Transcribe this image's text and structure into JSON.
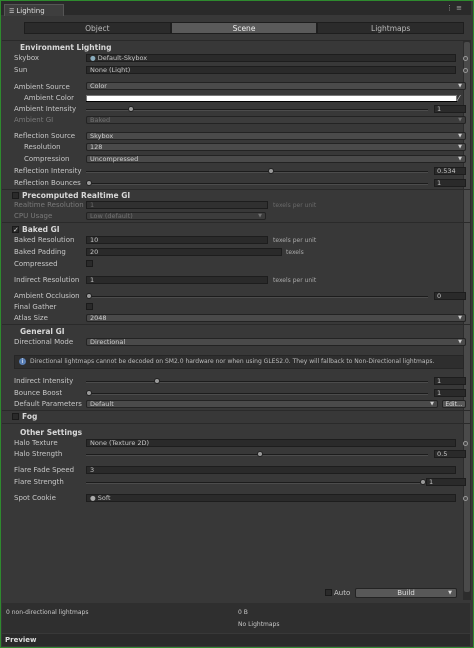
{
  "window": {
    "tab_title": "Lighting"
  },
  "modes": [
    "Object",
    "Scene",
    "Lightmaps"
  ],
  "environment": {
    "title": "Environment Lighting",
    "skybox_label": "Skybox",
    "skybox_value": "Default-Skybox",
    "sun_label": "Sun",
    "sun_value": "None (Light)",
    "ambient_source_label": "Ambient Source",
    "ambient_source_value": "Color",
    "ambient_color_label": "Ambient Color",
    "ambient_intensity_label": "Ambient Intensity",
    "ambient_intensity_value": "1",
    "ambient_gi_label": "Ambient GI",
    "ambient_gi_value": "Baked",
    "reflection_source_label": "Reflection Source",
    "reflection_source_value": "Skybox",
    "resolution_label": "Resolution",
    "resolution_value": "128",
    "compression_label": "Compression",
    "compression_value": "Uncompressed",
    "reflection_intensity_label": "Reflection Intensity",
    "reflection_intensity_value": "0.534",
    "reflection_bounces_label": "Reflection Bounces",
    "reflection_bounces_value": "1"
  },
  "realtime": {
    "title": "Precomputed Realtime GI",
    "resolution_label": "Realtime Resolution",
    "resolution_value": "1",
    "unit": "texels per unit",
    "cpu_label": "CPU Usage",
    "cpu_value": "Low (default)"
  },
  "baked": {
    "title": "Baked GI",
    "resolution_label": "Baked Resolution",
    "resolution_value": "10",
    "resolution_unit": "texels per unit",
    "padding_label": "Baked Padding",
    "padding_value": "20",
    "padding_unit": "texels",
    "compressed_label": "Compressed",
    "indirect_label": "Indirect Resolution",
    "indirect_value": "1",
    "indirect_unit": "texels per unit",
    "ao_label": "Ambient Occlusion",
    "ao_value": "0",
    "final_gather_label": "Final Gather",
    "atlas_label": "Atlas Size",
    "atlas_value": "2048"
  },
  "general": {
    "title": "General GI",
    "directional_label": "Directional Mode",
    "directional_value": "Directional",
    "info_text": "Directional lightmaps cannot be decoded on SM2.0 hardware nor when using GLES2.0. They will fallback to Non-Directional lightmaps.",
    "indirect_intensity_label": "Indirect Intensity",
    "indirect_intensity_value": "1",
    "bounce_label": "Bounce Boost",
    "bounce_value": "1",
    "default_params_label": "Default Parameters",
    "default_params_value": "Default",
    "edit_label": "Edit..."
  },
  "fog": {
    "title": "Fog"
  },
  "other": {
    "title": "Other Settings",
    "halo_texture_label": "Halo Texture",
    "halo_texture_value": "None (Texture 2D)",
    "halo_strength_label": "Halo Strength",
    "halo_strength_value": "0.5",
    "flare_fade_label": "Flare Fade Speed",
    "flare_fade_value": "3",
    "flare_strength_label": "Flare Strength",
    "flare_strength_value": "1",
    "spot_cookie_label": "Spot Cookie",
    "spot_cookie_value": "Soft"
  },
  "build": {
    "auto_label": "Auto",
    "build_label": "Build"
  },
  "stats": {
    "lightmaps_count": "0 non-directional lightmaps",
    "size": "0 B",
    "no_lightmaps": "No Lightmaps"
  },
  "preview": {
    "label": "Preview"
  }
}
